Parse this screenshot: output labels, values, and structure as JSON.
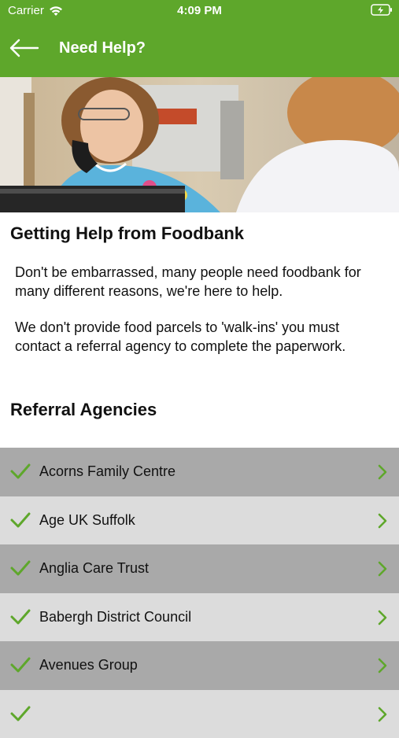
{
  "status_bar": {
    "carrier": "Carrier",
    "time": "4:09 PM"
  },
  "navbar": {
    "title": "Need Help?",
    "back_icon": "arrow-left-icon"
  },
  "hero": {
    "description": "photo of smiling woman on phone at office desk"
  },
  "main": {
    "heading": "Getting Help from Foodbank",
    "paragraph1": "Don't be embarrassed, many people need foodbank for many different reasons, we're here to help.",
    "paragraph2": "We don't provide food parcels to 'walk-ins' you must contact a referral agency to complete the paperwork.",
    "agencies_heading": "Referral Agencies"
  },
  "agencies": [
    {
      "label": "Acorns Family Centre"
    },
    {
      "label": "Age UK Suffolk"
    },
    {
      "label": "Anglia Care Trust"
    },
    {
      "label": "Babergh District Council"
    },
    {
      "label": "Avenues Group"
    },
    {
      "label": ""
    }
  ],
  "colors": {
    "accent": "#5ea72b",
    "row_dark": "#a9a9a9",
    "row_light": "#dcdcdc",
    "check": "#5ea72b"
  }
}
